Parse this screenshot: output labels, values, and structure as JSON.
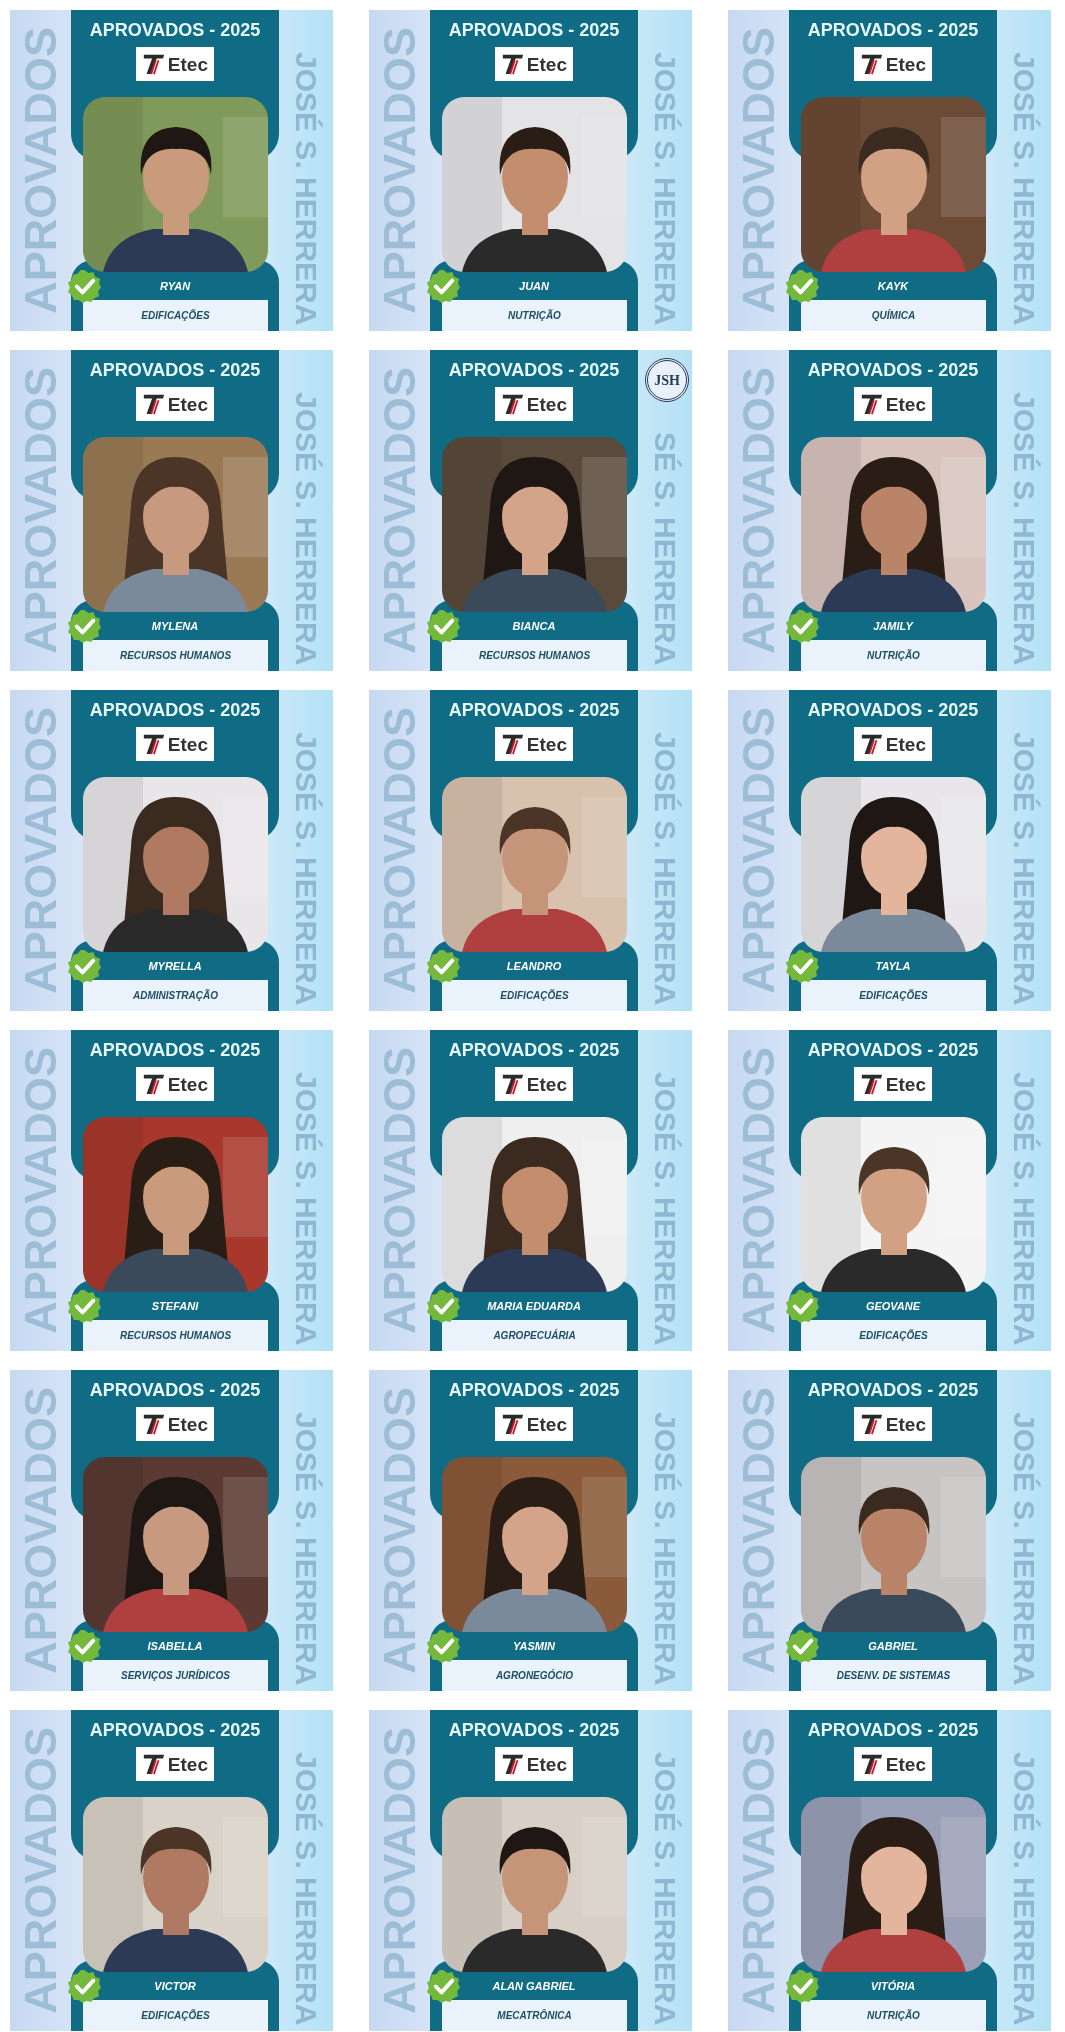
{
  "posts": [
    {
      "headline": "APROVADOS - 2025",
      "logo": "Etec",
      "side_left": "APROVADOS",
      "side_right": "JOSÉ S. HERRERA",
      "name": "RYAN",
      "course": "EDIFICAÇÕES",
      "verified": true
    },
    {
      "headline": "APROVADOS - 2025",
      "logo": "Etec",
      "side_left": "APROVADOS",
      "side_right": "JOSÉ S. HERRERA",
      "name": "JUAN",
      "course": "NUTRIÇÃO",
      "verified": true
    },
    {
      "headline": "APROVADOS - 2025",
      "logo": "Etec",
      "side_left": "APROVADOS",
      "side_right": "JOSÉ S. HERRERA",
      "name": "KAYK",
      "course": "QUÍMICA",
      "verified": true
    },
    {
      "headline": "APROVADOS - 2025",
      "logo": "Etec",
      "side_left": "APROVADOS",
      "side_right": "JOSÉ S. HERRERA",
      "name": "MYLENA",
      "course": "RECURSOS HUMANOS",
      "verified": true
    },
    {
      "headline": "APROVADOS - 2025",
      "logo": "Etec",
      "side_left": "APROVADOS",
      "side_right": "SÉ S. HERRERA",
      "name": "BIANCA",
      "course": "RECURSOS HUMANOS",
      "verified": true,
      "seal": "JSH"
    },
    {
      "headline": "APROVADOS - 2025",
      "logo": "Etec",
      "side_left": "APROVADOS",
      "side_right": "JOSÉ S. HERRERA",
      "name": "JAMILY",
      "course": "NUTRIÇÃO",
      "verified": true
    },
    {
      "headline": "APROVADOS - 2025",
      "logo": "Etec",
      "side_left": "APROVADOS",
      "side_right": "JOSÉ S. HERRERA",
      "name": "MYRELLA",
      "course": "ADMINISTRAÇÃO",
      "verified": true
    },
    {
      "headline": "APROVADOS - 2025",
      "logo": "Etec",
      "side_left": "APROVADOS",
      "side_right": "JOSÉ S. HERRERA",
      "name": "LEANDRO",
      "course": "EDIFICAÇÕES",
      "verified": true
    },
    {
      "headline": "APROVADOS - 2025",
      "logo": "Etec",
      "side_left": "APROVADOS",
      "side_right": "JOSÉ S. HERRERA",
      "name": "TAYLA",
      "course": "EDIFICAÇÕES",
      "verified": true
    },
    {
      "headline": "APROVADOS - 2025",
      "logo": "Etec",
      "side_left": "APROVADOS",
      "side_right": "JOSÉ S. HERRERA",
      "name": "STEFANI",
      "course": "RECURSOS HUMANOS",
      "verified": true
    },
    {
      "headline": "APROVADOS - 2025",
      "logo": "Etec",
      "side_left": "APROVADOS",
      "side_right": "JOSÉ S. HERRERA",
      "name": "MARIA EDUARDA",
      "course": "AGROPECUÁRIA",
      "verified": true
    },
    {
      "headline": "APROVADOS - 2025",
      "logo": "Etec",
      "side_left": "APROVADOS",
      "side_right": "JOSÉ S. HERRERA",
      "name": "GEOVANE",
      "course": "EDIFICAÇÕES",
      "verified": true
    },
    {
      "headline": "APROVADOS - 2025",
      "logo": "Etec",
      "side_left": "APROVADOS",
      "side_right": "JOSÉ S. HERRERA",
      "name": "ISABELLA",
      "course": "SERVIÇOS JURÍDICOS",
      "verified": true
    },
    {
      "headline": "APROVADOS - 2025",
      "logo": "Etec",
      "side_left": "APROVADOS",
      "side_right": "JOSÉ S. HERRERA",
      "name": "YASMIN",
      "course": "AGRONEGÓCIO",
      "verified": true
    },
    {
      "headline": "APROVADOS - 2025",
      "logo": "Etec",
      "side_left": "APROVADOS",
      "side_right": "JOSÉ S. HERRERA",
      "name": "GABRIEL",
      "course": "DESENV. DE SISTEMAS",
      "verified": true
    },
    {
      "headline": "APROVADOS - 2025",
      "logo": "Etec",
      "side_left": "APROVADOS",
      "side_right": "JOSÉ S. HERRERA",
      "name": "VICTOR",
      "course": "EDIFICAÇÕES",
      "verified": true
    },
    {
      "headline": "APROVADOS - 2025",
      "logo": "Etec",
      "side_left": "APROVADOS",
      "side_right": "JOSÉ S. HERRERA",
      "name": "ALAN GABRIEL",
      "course": "MECATRÔNICA",
      "verified": true
    },
    {
      "headline": "APROVADOS - 2025",
      "logo": "Etec",
      "side_left": "APROVADOS",
      "side_right": "JOSÉ S. HERRERA",
      "name": "VITÓRIA",
      "course": "NUTRIÇÃO",
      "verified": true
    }
  ]
}
